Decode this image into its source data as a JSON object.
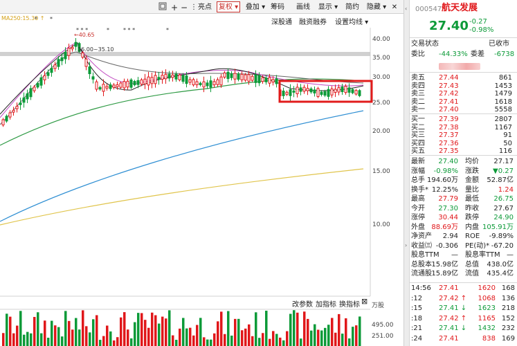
{
  "toolbar": {
    "buttons": [
      "亮点",
      "复权",
      "叠加",
      "筹码",
      "画线",
      "显示",
      "简约",
      "隐藏"
    ],
    "active_index": 1
  },
  "chart": {
    "ma_label": "MA250:15.30",
    "links": [
      "深股通",
      "融资融券",
      "设置均线"
    ],
    "high_marker": "40.65",
    "range_marker": "36.00~35.10",
    "price_axis": [
      "40.00",
      "35.00",
      "30.00",
      "25.00",
      "20.00",
      "15.00",
      "10.00"
    ],
    "volume_links": [
      "改参数",
      "加指标",
      "换指标"
    ],
    "volume_axis": [
      "万股",
      "495.00",
      "251.00"
    ]
  },
  "quote": {
    "code": "000547",
    "name": "航天发展",
    "price": "27.40",
    "change": "-0.27",
    "change_pct": "-0.98%",
    "trade_status_label": "交易状态",
    "trade_status": "已收市",
    "weibi_label": "委比",
    "weibi": "-44.33%",
    "weicha_label": "委差",
    "weicha": "-6738"
  },
  "order_book": {
    "sells": [
      {
        "label": "卖五",
        "price": "27.44",
        "vol": "861"
      },
      {
        "label": "卖四",
        "price": "27.43",
        "vol": "1453"
      },
      {
        "label": "卖三",
        "price": "27.42",
        "vol": "1479"
      },
      {
        "label": "卖二",
        "price": "27.41",
        "vol": "1618"
      },
      {
        "label": "卖一",
        "price": "27.40",
        "vol": "5558"
      }
    ],
    "buys": [
      {
        "label": "买一",
        "price": "27.39",
        "vol": "2807"
      },
      {
        "label": "买二",
        "price": "27.38",
        "vol": "1167"
      },
      {
        "label": "买三",
        "price": "27.37",
        "vol": "91"
      },
      {
        "label": "买四",
        "price": "27.36",
        "vol": "50"
      },
      {
        "label": "买五",
        "price": "27.35",
        "vol": "116"
      }
    ]
  },
  "stats": [
    {
      "l1": "最新",
      "v1": "27.40",
      "c1": "green",
      "l2": "均价",
      "v2": "27.17",
      "c2": "dark"
    },
    {
      "l1": "涨幅",
      "v1": "-0.98%",
      "c1": "green",
      "l2": "涨跌",
      "v2": "▼0.27",
      "c2": "green"
    },
    {
      "l1": "总手",
      "v1": "194.60万",
      "c1": "dark",
      "l2": "金额",
      "v2": "52.87亿",
      "c2": "dark"
    },
    {
      "l1": "换手*",
      "v1": "12.25%",
      "c1": "dark",
      "l2": "量比",
      "v2": "1.24",
      "c2": "red"
    },
    {
      "l1": "最高",
      "v1": "27.79",
      "c1": "red",
      "l2": "最低",
      "v2": "26.75",
      "c2": "green"
    },
    {
      "l1": "今开",
      "v1": "27.30",
      "c1": "green",
      "l2": "昨收",
      "v2": "27.67",
      "c2": "dark"
    },
    {
      "l1": "涨停",
      "v1": "30.44",
      "c1": "red",
      "l2": "跌停",
      "v2": "24.90",
      "c2": "green"
    },
    {
      "l1": "外盘",
      "v1": "88.69万",
      "c1": "red",
      "l2": "内盘",
      "v2": "105.91万",
      "c2": "green"
    },
    {
      "l1": "净资产",
      "v1": "2.94",
      "c1": "dark",
      "l2": "ROE",
      "v2": "-9.89%",
      "c2": "dark"
    },
    {
      "l1": "收益㈢",
      "v1": "-0.306",
      "c1": "dark",
      "l2": "PE(动)*",
      "v2": "-67.20",
      "c2": "dark"
    },
    {
      "l1": "股息TTM",
      "v1": "—",
      "c1": "dark",
      "l2": "股息率TTM",
      "v2": "—",
      "c2": "dark"
    },
    {
      "l1": "总股本",
      "v1": "15.98亿",
      "c1": "dark",
      "l2": "总值",
      "v2": "438.0亿",
      "c2": "dark"
    },
    {
      "l1": "流通股",
      "v1": "15.89亿",
      "c1": "dark",
      "l2": "流值",
      "v2": "435.4亿",
      "c2": "dark"
    }
  ],
  "ticks": [
    {
      "time": "14:56",
      "price": "27.41",
      "arrow": "",
      "vol": "1620",
      "n": "168",
      "vc": "red"
    },
    {
      "time": ":12",
      "price": "27.42",
      "arrow": "↑",
      "vol": "1068",
      "n": "136",
      "vc": "red"
    },
    {
      "time": ":15",
      "price": "27.41",
      "arrow": "↓",
      "vol": "1623",
      "n": "218",
      "vc": "green"
    },
    {
      "time": ":18",
      "price": "27.42",
      "arrow": "↑",
      "vol": "1165",
      "n": "152",
      "vc": "red"
    },
    {
      "time": ":21",
      "price": "27.41",
      "arrow": "↓",
      "vol": "1432",
      "n": "232",
      "vc": "green"
    },
    {
      "time": ":24",
      "price": "27.41",
      "arrow": "",
      "vol": "838",
      "n": "169",
      "vc": "red"
    }
  ],
  "colors": {
    "up": "#e0171a",
    "down": "#0c9a38",
    "highlight": "#e11b1b"
  }
}
